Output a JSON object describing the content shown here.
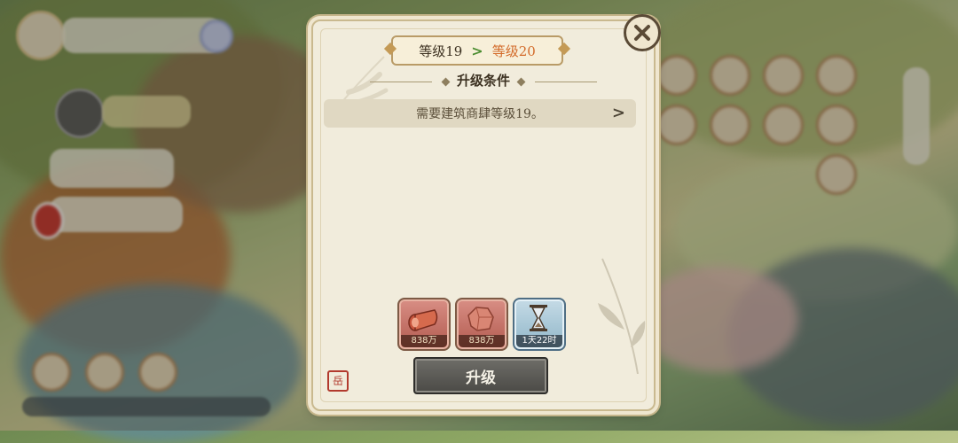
{
  "dialog": {
    "current_level": "等级19",
    "next_level": "等级20",
    "section_title": "升级条件",
    "requirement_text": "需要建筑商肆等级19。",
    "resources": [
      {
        "icon": "wood-log-icon",
        "amount": "838万"
      },
      {
        "icon": "stone-icon",
        "amount": "838万"
      },
      {
        "icon": "hourglass-icon",
        "amount": "1天22时"
      }
    ],
    "upgrade_label": "升级",
    "seal_text": "岳"
  },
  "colors": {
    "next_level": "#d36b2a",
    "arrow": "#4a8c2f",
    "button": "#5a5955",
    "panel": "#f1ecdc"
  }
}
